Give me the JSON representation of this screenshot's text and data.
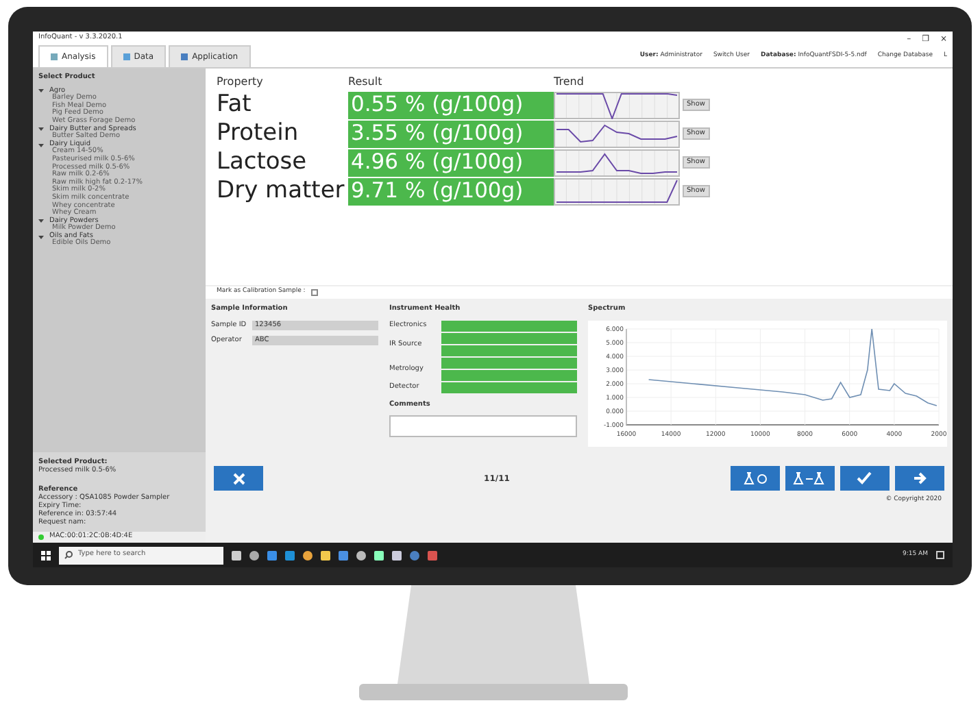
{
  "window": {
    "title": "InfoQuant - v 3.3.2020.1",
    "controls": [
      "–",
      "❐",
      "×"
    ]
  },
  "tabs": [
    {
      "label": "Analysis",
      "selected": true
    },
    {
      "label": "Data",
      "selected": false
    },
    {
      "label": "Application",
      "selected": false
    }
  ],
  "header": {
    "user_label": "User:",
    "user": "Administrator",
    "switch_user": "Switch User",
    "database_label": "Database:",
    "database": "InfoQuantFSDI-5-5.ndf",
    "change_database": "Change Database",
    "language": "L"
  },
  "sidebar": {
    "title": "Select Product",
    "items": [
      {
        "label": "Agro",
        "expanded": true,
        "children": [
          {
            "label": "Barley Demo"
          },
          {
            "label": "Fish Meal Demo"
          },
          {
            "label": "Pig Feed Demo"
          },
          {
            "label": "Wet Grass Forage Demo"
          }
        ]
      },
      {
        "label": "Dairy Butter and Spreads",
        "expanded": true,
        "children": [
          {
            "label": "Butter Salted Demo"
          }
        ]
      },
      {
        "label": "Dairy Liquid",
        "expanded": true,
        "children": [
          {
            "label": "Cream 14-50%"
          },
          {
            "label": "Pasteurised milk 0.5-6%"
          },
          {
            "label": "Processed milk 0.5-6%"
          },
          {
            "label": "Raw milk 0.2-6%"
          },
          {
            "label": "Raw milk high fat 0.2-17%"
          },
          {
            "label": "Skim milk 0-2%"
          },
          {
            "label": "Skim milk concentrate"
          },
          {
            "label": "Whey concentrate"
          },
          {
            "label": "Whey Cream"
          }
        ]
      },
      {
        "label": "Dairy Powders",
        "expanded": true,
        "children": [
          {
            "label": "Milk Powder Demo"
          }
        ]
      },
      {
        "label": "Oils and Fats",
        "expanded": true,
        "children": [
          {
            "label": "Edible Oils Demo"
          }
        ]
      }
    ],
    "selected_title": "Selected Product:",
    "selected_product": "Processed milk 0.5-6%",
    "reference_title": "Reference",
    "reference_lines": [
      "Accessory : QSA1085 Powder Sampler",
      "Expiry Time:",
      "Reference in: 03:57:44",
      "Request nam:"
    ],
    "status": "MAC:00:01:2C:0B:4D:4E"
  },
  "results": {
    "columns": [
      "Property",
      "Result",
      "Trend"
    ],
    "rows": [
      {
        "property": "Fat",
        "result": "0.55 % (g/100g)",
        "color": "#4cb84c",
        "action": "Show"
      },
      {
        "property": "Protein",
        "result": "3.55 % (g/100g)",
        "color": "#4cb84c",
        "action": "Show"
      },
      {
        "property": "Lactose",
        "result": "4.96 % (g/100g)",
        "color": "#4cb84c",
        "action": "Show"
      },
      {
        "property": "Dry matter",
        "result": "9.71 % (g/100g)",
        "color": "#4cb84c",
        "action": "Show"
      }
    ],
    "calibration_label": "Mark as Calibration Sample :",
    "calibration_checked": false
  },
  "sample_info": {
    "title": "Sample Information",
    "fields": [
      {
        "label": "Sample ID",
        "value": "123456"
      },
      {
        "label": "Operator",
        "value": "ABC"
      }
    ]
  },
  "instrument_health": {
    "title": "Instrument Health",
    "items": [
      {
        "label": "Electronics",
        "cells": [
          {
            "color": "#4cb84c"
          }
        ]
      },
      {
        "label": "IR Source",
        "cells": [
          {
            "color": "#4cb84c"
          },
          {
            "color": "#4cb84c"
          }
        ]
      },
      {
        "label": "Metrology",
        "cells": [
          {
            "color": "#4cb84c"
          },
          {
            "color": "#4cb84c"
          }
        ]
      },
      {
        "label": "Detector",
        "cells": [
          {
            "color": "#4cb84c"
          }
        ]
      }
    ],
    "comments_title": "Comments"
  },
  "spectrum": {
    "title": "Spectrum",
    "chart_data": {
      "type": "line",
      "x": [
        15000,
        13000,
        11000,
        9000,
        8000,
        7200,
        6800,
        6400,
        6000,
        5500,
        5200,
        5000,
        4700,
        4200,
        4000,
        3500,
        3000,
        2500,
        2100
      ],
      "grid": true,
      "series": [
        {
          "color": "#6f8fb3",
          "values": [
            2.3,
            2.0,
            1.7,
            1.4,
            1.2,
            0.8,
            0.9,
            2.1,
            1.0,
            1.2,
            3.0,
            6.0,
            1.6,
            1.5,
            2.0,
            1.3,
            1.1,
            0.6,
            0.4
          ]
        }
      ],
      "xlim": [
        16000,
        2000
      ],
      "ylim": [
        -1,
        6
      ],
      "xticks": [
        16000,
        14000,
        12000,
        10000,
        8000,
        6000,
        4000,
        2000
      ],
      "yticks": [
        {
          "value": 6,
          "label": "6.000"
        },
        {
          "value": 5,
          "label": "5.000"
        },
        {
          "value": 4,
          "label": "4.000"
        },
        {
          "value": 3,
          "label": "3.000"
        },
        {
          "value": 2,
          "label": "2.000"
        },
        {
          "value": 1,
          "label": "1.000"
        },
        {
          "value": 0,
          "label": "0.000"
        },
        {
          "value": -1,
          "label": "-1.000"
        }
      ]
    }
  },
  "actions": {
    "counter": "11/11",
    "copyright": "© Copyright 2020"
  },
  "taskbar": {
    "search_placeholder": "Type here to search",
    "time": "9:15 AM"
  }
}
